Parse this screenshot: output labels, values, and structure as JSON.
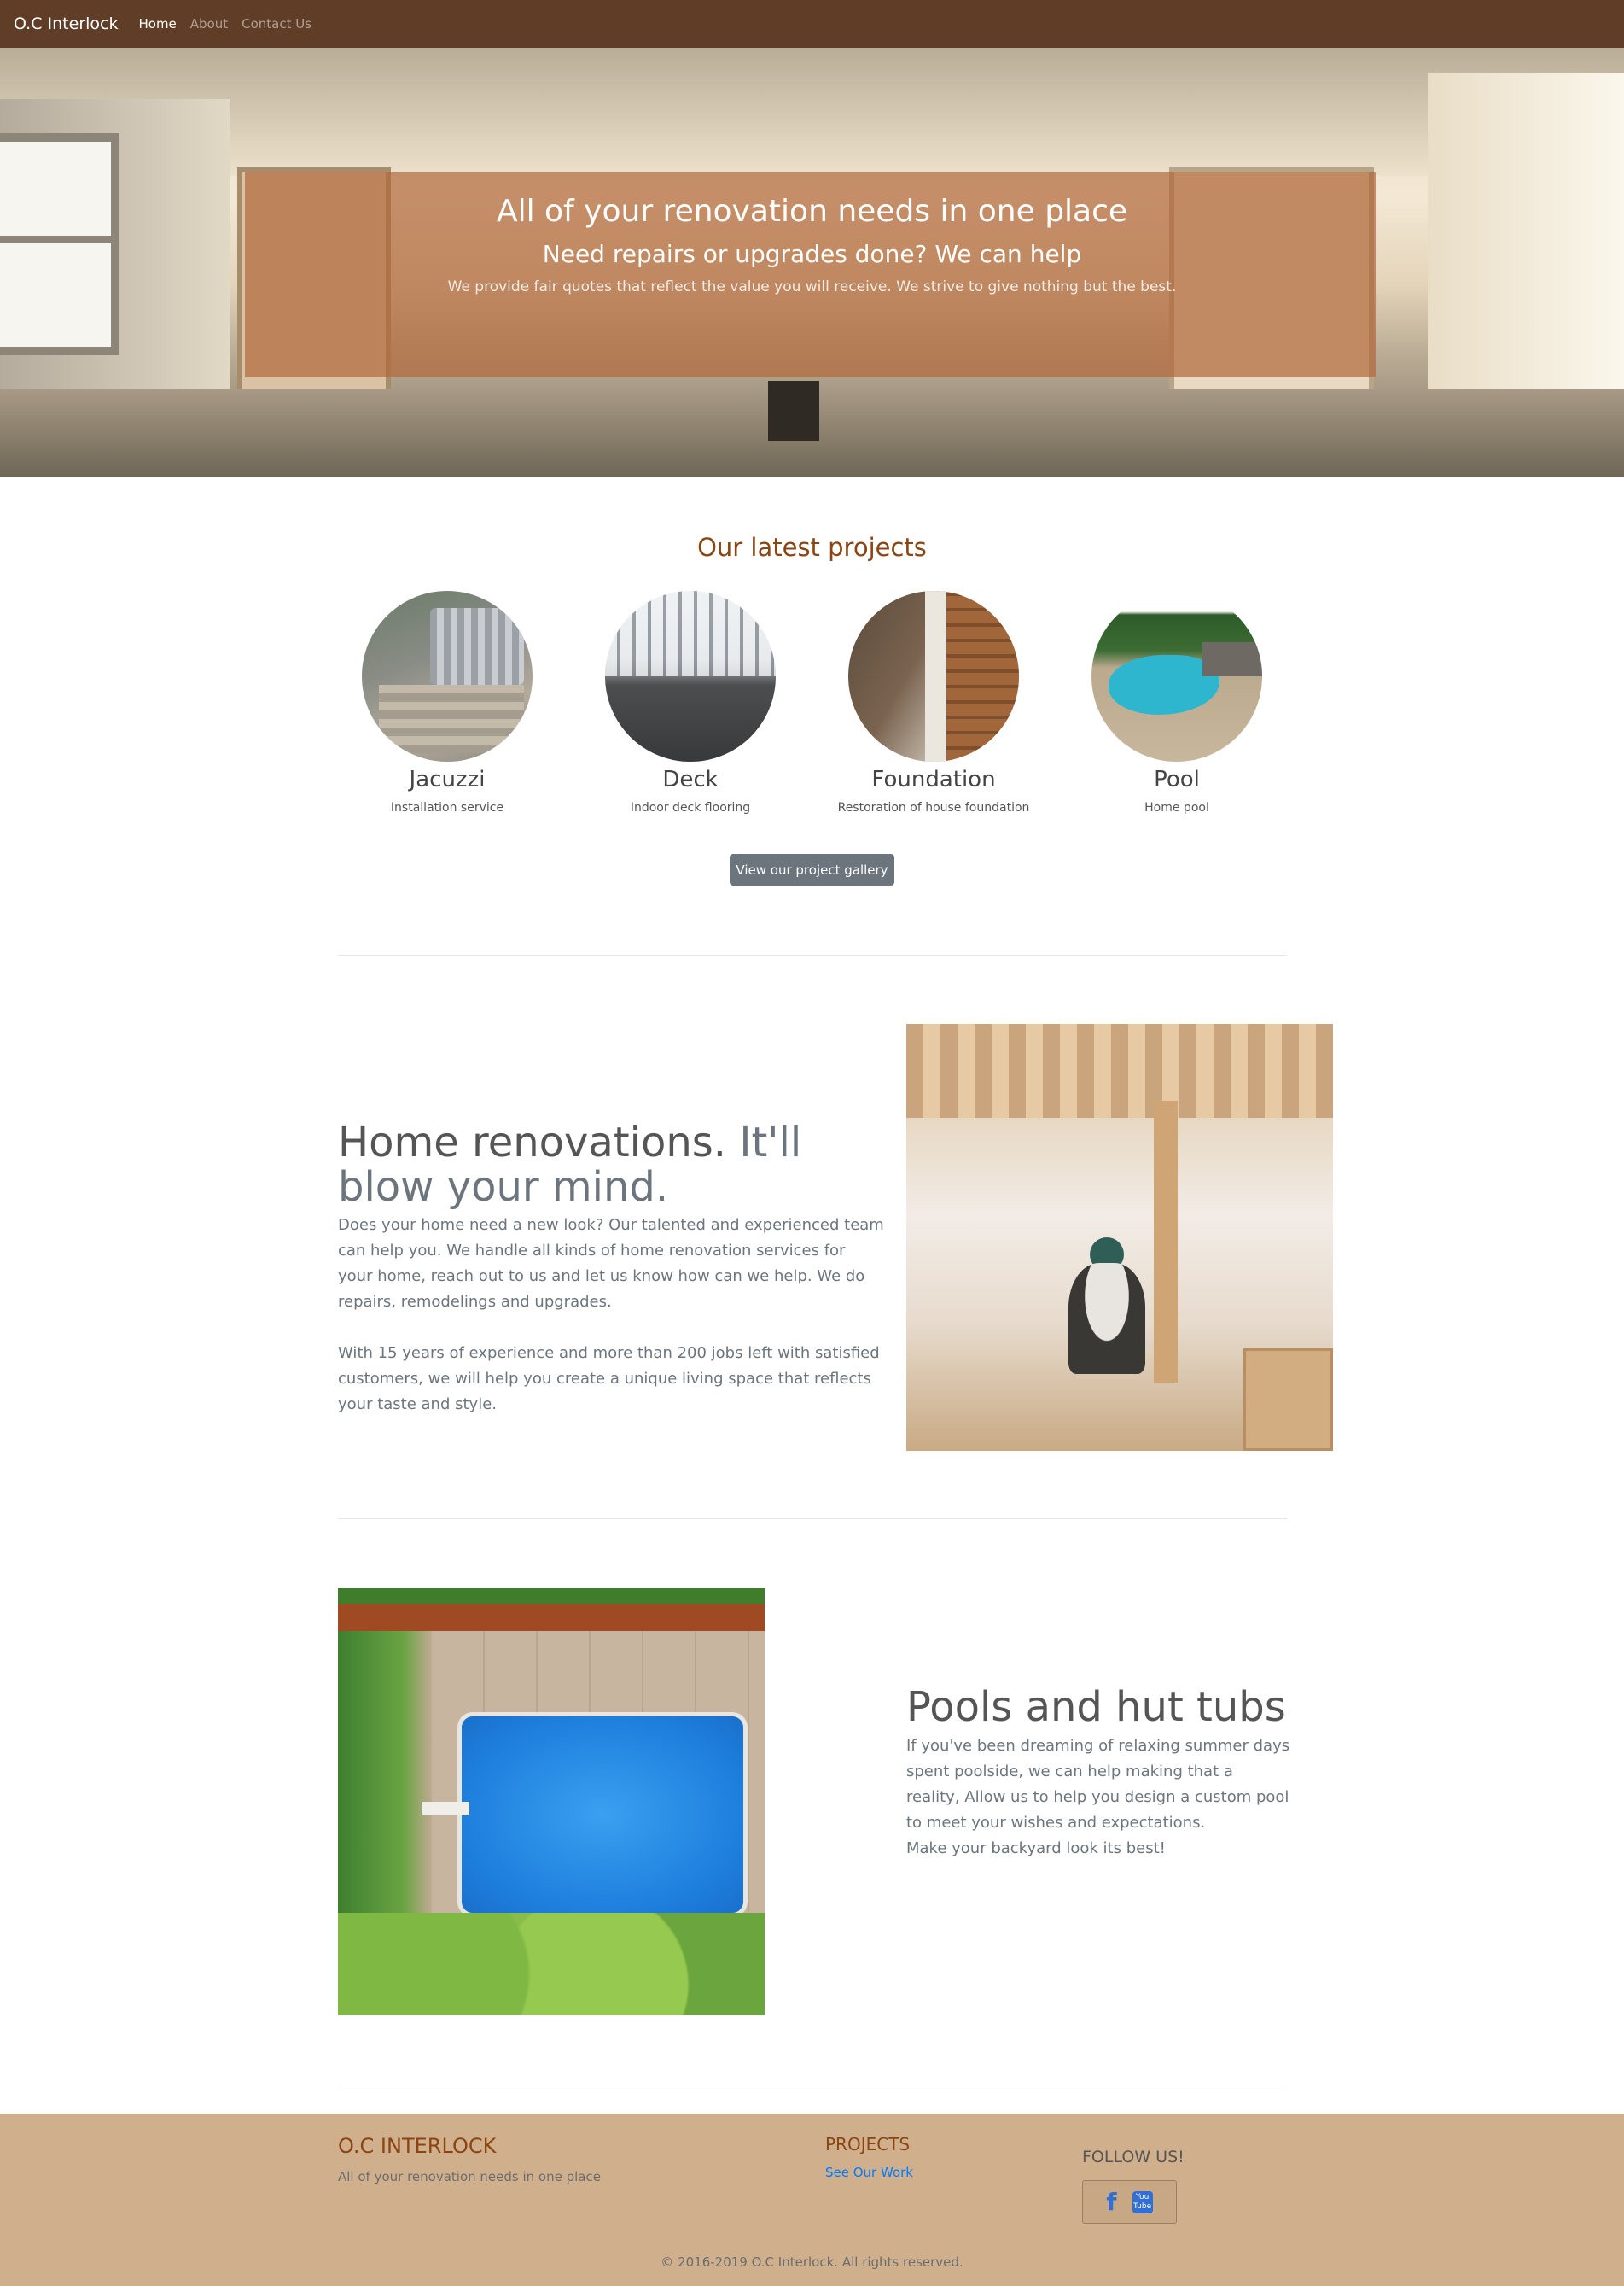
{
  "navbar": {
    "brand": "O.C Interlock",
    "links": [
      {
        "label": "Home",
        "active": true
      },
      {
        "label": "About",
        "active": false
      },
      {
        "label": "Contact Us",
        "active": false
      }
    ],
    "background": "#5f3d26"
  },
  "hero": {
    "title": "All of your renovation needs in one place",
    "subtitle": "Need repairs or upgrades done? We can help",
    "lead": "We provide fair quotes that reflect the value you will receive. We strive to give nothing but the best."
  },
  "projects": {
    "title": "Our latest projects",
    "items": [
      {
        "name": "Jacuzzi",
        "description": "Installation service"
      },
      {
        "name": "Deck",
        "description": "Indoor deck flooring"
      },
      {
        "name": "Foundation",
        "description": "Restoration of house foundation"
      },
      {
        "name": "Pool",
        "description": "Home pool"
      }
    ],
    "gallery_button": "View our project gallery"
  },
  "feature_renovations": {
    "heading": "Home renovations.",
    "heading_muted": "It'll blow your mind.",
    "paragraphs": [
      "Does your home need a new look? Our talented and experienced team can help you. We handle all kinds of home renovation services for your home, reach out to us and let us know how can we help. We do repairs, remodelings and upgrades.",
      "With 15 years of experience and more than 200 jobs left with satisfied customers, we will help you create a unique living space that reflects your taste and style."
    ]
  },
  "feature_pools": {
    "heading": "Pools and hut tubs",
    "lines": [
      "If you've been dreaming of relaxing summer days spent poolside, we can help making that a reality, Allow us to help you design a custom pool to meet your wishes and expectations.",
      "Make your backyard look its best!"
    ]
  },
  "footer": {
    "brand": "O.C INTERLOCK",
    "tagline": "All of your renovation needs in one place",
    "projects_title": "PROJECTS",
    "projects_link": "See Our Work",
    "follow_title": "FOLLOW US!",
    "social_icons": [
      "facebook-icon",
      "youtube-icon"
    ],
    "youtube_glyph_top": "You",
    "youtube_glyph_bottom": "Tube",
    "facebook_glyph": "f",
    "copyright": "© 2016-2019 O.C Interlock. All rights reserved.",
    "background": "#d0b08c"
  },
  "colors": {
    "accent_brown": "#8b4513",
    "button_gray": "#6c757d",
    "link_blue": "#007bff",
    "hero_overlay": "#b0683a"
  }
}
